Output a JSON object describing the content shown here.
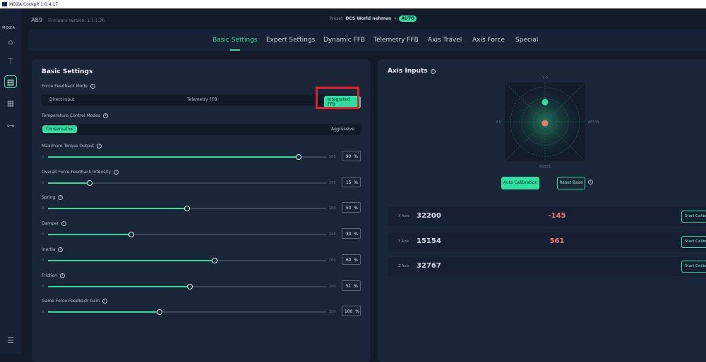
{
  "window": {
    "title": "MOZA Cockpit 1.0.4.17"
  },
  "brand": "MOZA",
  "device": {
    "name": "AB9",
    "firmware": "Firmware Version: 1.1.1.26"
  },
  "preset": {
    "label": "Preset",
    "value": "DCS World nehmen",
    "badge": "AUTO"
  },
  "tabs": [
    {
      "label": "Basic Settings",
      "active": true
    },
    {
      "label": "Expert Settings"
    },
    {
      "label": "Dynamic FFB"
    },
    {
      "label": "Telemetry FFB"
    },
    {
      "label": "Axis Travel"
    },
    {
      "label": "Axis Force"
    },
    {
      "label": "Special"
    }
  ],
  "basic": {
    "title": "Basic Settings",
    "ffb_mode": {
      "label": "Force Feedback Mode",
      "options": [
        "Direct Input",
        "Telemetry FFB",
        "Integrated FFB"
      ],
      "selected": "Integrated FFB"
    },
    "temp_mode": {
      "label": "Temperature Control Modes",
      "options": [
        "Conservative",
        "Aggressive"
      ],
      "selected": "Conservative"
    },
    "sliders": [
      {
        "label": "Maximum Torque Output",
        "min": "0",
        "max": "100",
        "value": 90,
        "display": "90",
        "unit": "%"
      },
      {
        "label": "Overall Force Feedback Intensity",
        "min": "0",
        "max": "100",
        "value": 15,
        "display": "15",
        "unit": "%"
      },
      {
        "label": "Spring",
        "min": "0",
        "max": "100",
        "value": 50,
        "display": "50",
        "unit": "%"
      },
      {
        "label": "Damper",
        "min": "0",
        "max": "100",
        "value": 30,
        "display": "30",
        "unit": "%"
      },
      {
        "label": "Inertia",
        "min": "0",
        "max": "100",
        "value": 60,
        "display": "60",
        "unit": "%"
      },
      {
        "label": "Friction",
        "min": "0",
        "max": "100",
        "value": 51,
        "display": "51",
        "unit": "%"
      },
      {
        "label": "Game Force Feedback Gain",
        "min": "0",
        "max": "250",
        "value": 100,
        "display": "100",
        "unit": "%"
      }
    ]
  },
  "axis": {
    "title": "Axis Inputs",
    "labels": {
      "top": "Y 0",
      "left": "X 0",
      "right": "65535",
      "bottom": "65535"
    },
    "auto_calibration": "Auto Calibration",
    "reset_base": "Reset Base",
    "rows": [
      {
        "name": "X Axis",
        "value": "32200",
        "delta": "-145",
        "button": "Start Calibration"
      },
      {
        "name": "Y Axis",
        "value": "15154",
        "delta": "561",
        "button": "Start Calibration"
      },
      {
        "name": "Z Axis",
        "value": "32767",
        "delta": "",
        "button": "Start Calibration"
      }
    ],
    "colors": {
      "accent": "#2fdfa2",
      "base_point": "#f0756a"
    }
  }
}
